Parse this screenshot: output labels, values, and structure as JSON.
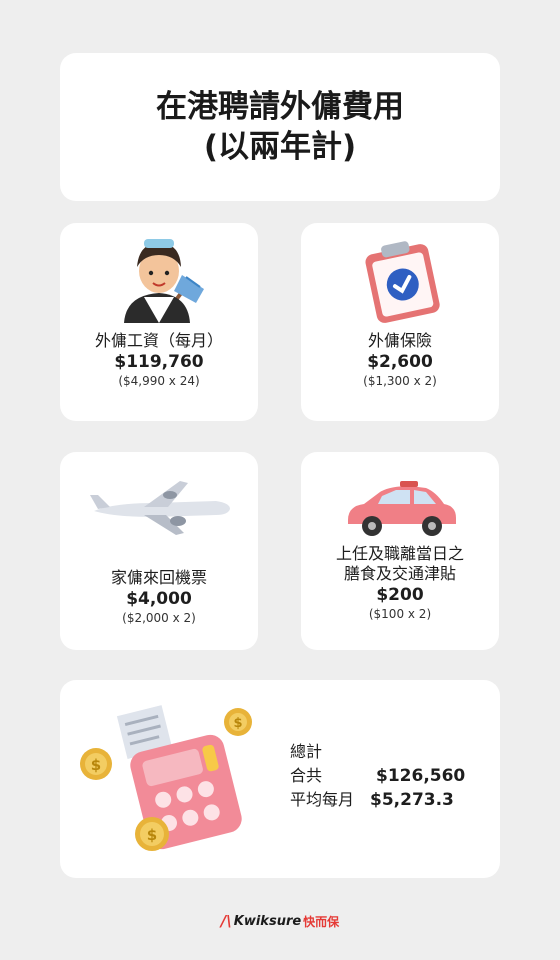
{
  "title": {
    "line1": "在港聘請外傭費用",
    "line2": "(以兩年計)"
  },
  "items": [
    {
      "label": "外傭工資（每月）",
      "amount": "$119,760",
      "calc": "($4,990 x 24)",
      "icon": "maid-icon"
    },
    {
      "label": "外傭保險",
      "amount": "$2,600",
      "calc": "($1,300 x 2)",
      "icon": "clipboard-check-icon"
    },
    {
      "label": "家傭來回機票",
      "amount": "$4,000",
      "calc": "($2,000 x 2)",
      "icon": "airplane-icon"
    },
    {
      "label_line1": "上任及職離當日之",
      "label_line2": "膳食及交通津貼",
      "amount": "$200",
      "calc": "($100 x 2)",
      "icon": "car-icon"
    }
  ],
  "total": {
    "heading": "總計",
    "sum_label": "合共",
    "sum_value": "$126,560",
    "avg_label": "平均每月",
    "avg_value": "$5,273.3",
    "icon": "calculator-coins-icon"
  },
  "logo": {
    "mark": "/\\",
    "brand": "Kwiksure",
    "brand_zh": "快而保"
  },
  "colors": {
    "background": "#eeeeee",
    "card": "#ffffff",
    "brand_red": "#e53935"
  }
}
